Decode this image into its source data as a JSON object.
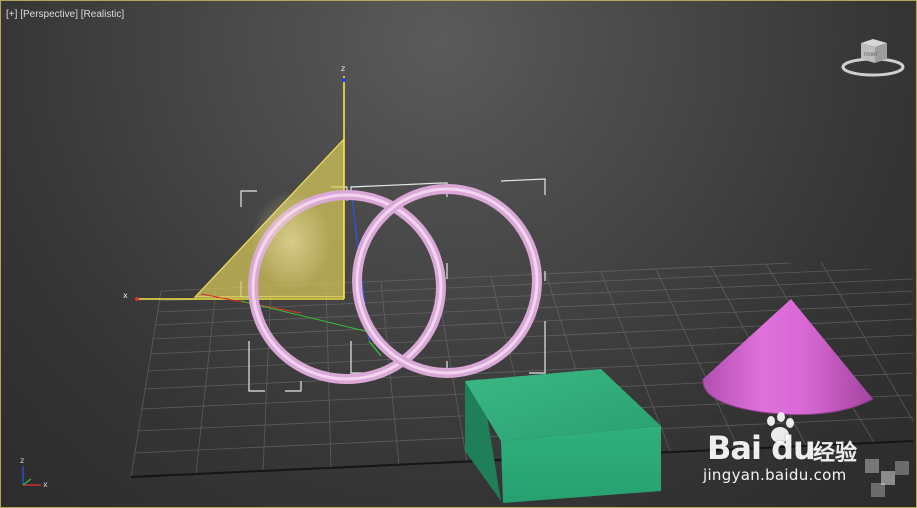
{
  "viewport": {
    "label_plus": "[+]",
    "label_view": "[Perspective]",
    "label_shading": "[Realistic]"
  },
  "gizmo": {
    "z_label": "z",
    "x_label": "x"
  },
  "mini_axis": {
    "z_label": "z",
    "x_label": "x"
  },
  "viewcube": {
    "face_label": "FRONT"
  },
  "objects": {
    "plane_color": "#e0d25a",
    "torus_color": "#e6b6e2",
    "box_color": "#2a9a6e",
    "cone_color": "#d86ad6"
  },
  "watermark": {
    "logo_text": "Bai du",
    "cn_text": "经验",
    "url_text": "jingyan.baidu.com"
  }
}
